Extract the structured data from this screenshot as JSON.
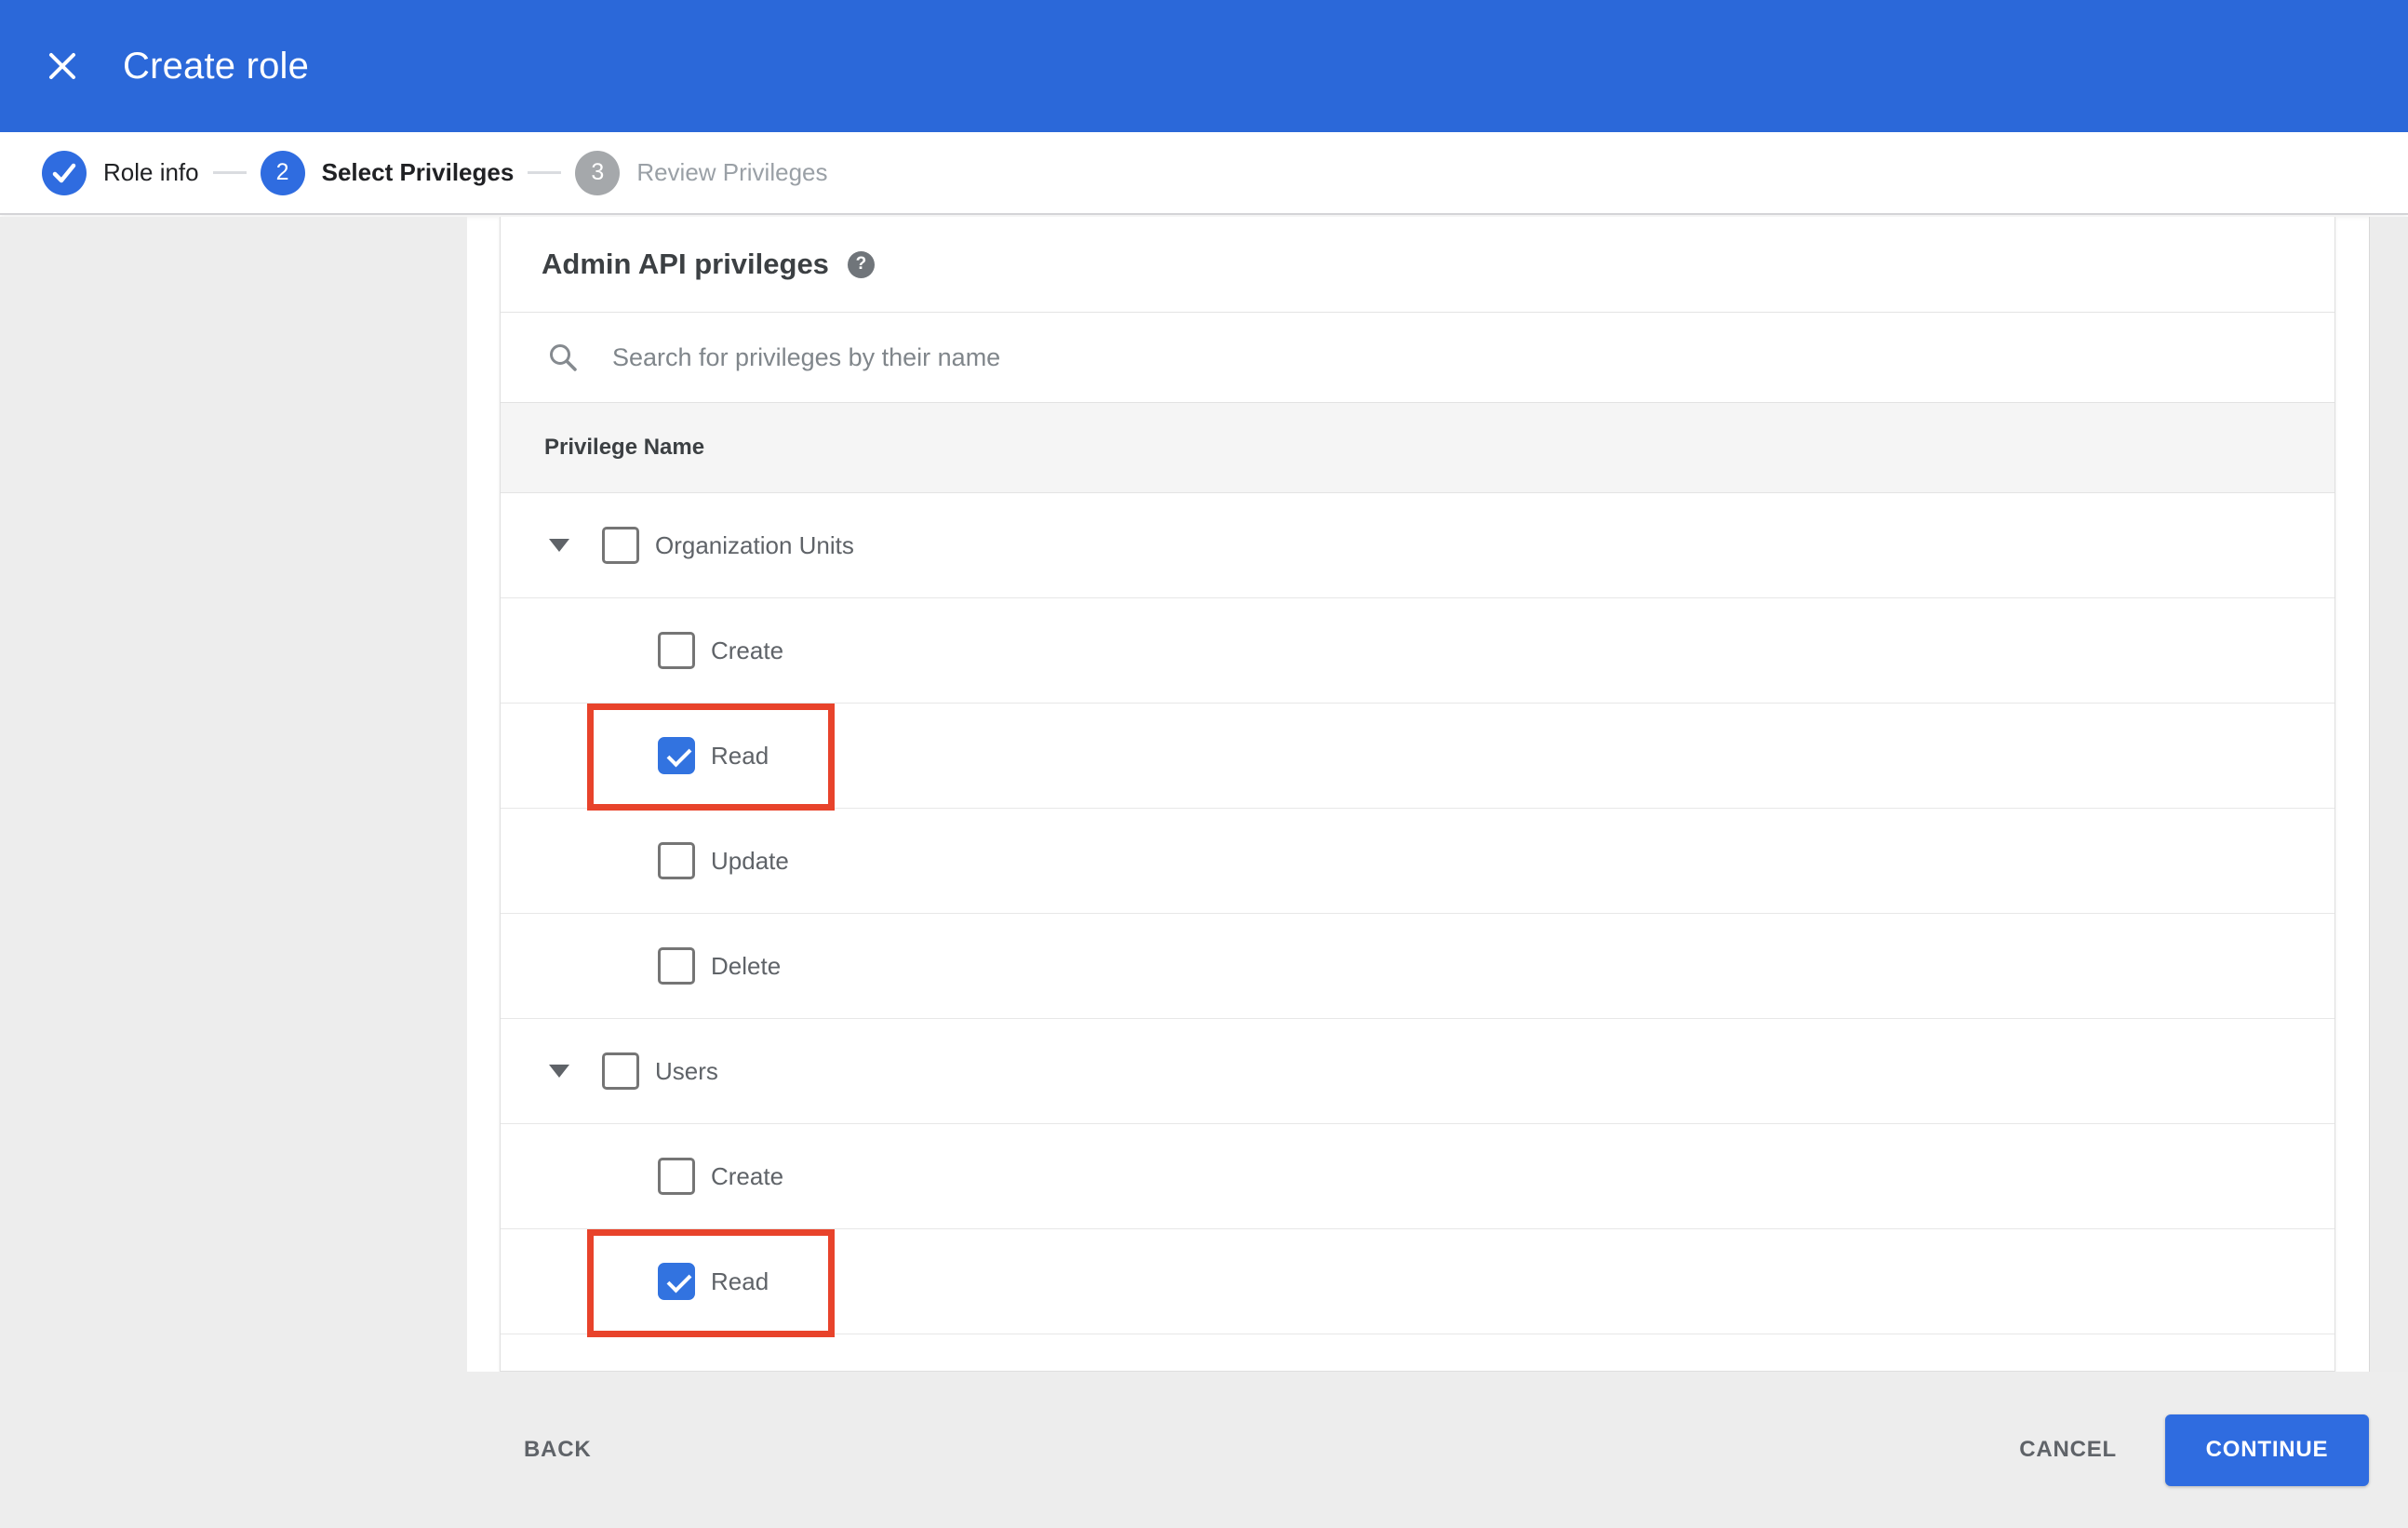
{
  "header": {
    "title": "Create role"
  },
  "stepper": {
    "steps": [
      {
        "label": "Role info",
        "state": "completed"
      },
      {
        "number": "2",
        "label": "Select Privileges",
        "state": "active"
      },
      {
        "number": "3",
        "label": "Review Privileges",
        "state": "upcoming"
      }
    ]
  },
  "panel": {
    "heading": "Admin API privileges",
    "help_icon": "?",
    "search_placeholder": "Search for privileges by their name",
    "search_value": "",
    "table_header": "Privilege Name",
    "groups": [
      {
        "label": "Organization Units",
        "checked": false,
        "expanded": true,
        "children": [
          {
            "label": "Create",
            "checked": false,
            "highlighted": false
          },
          {
            "label": "Read",
            "checked": true,
            "highlighted": true
          },
          {
            "label": "Update",
            "checked": false,
            "highlighted": false
          },
          {
            "label": "Delete",
            "checked": false,
            "highlighted": false
          }
        ]
      },
      {
        "label": "Users",
        "checked": false,
        "expanded": true,
        "children": [
          {
            "label": "Create",
            "checked": false,
            "highlighted": false
          },
          {
            "label": "Read",
            "checked": true,
            "highlighted": true
          }
        ]
      }
    ]
  },
  "footer": {
    "back_label": "BACK",
    "cancel_label": "CANCEL",
    "continue_label": "CONTINUE"
  },
  "colors": {
    "header_blue": "#2b68d9",
    "accent_blue": "#2f6ce0",
    "checkbox_blue": "#3273e0",
    "annotation_red": "#e8432b",
    "panel_gray": "#ededed",
    "band_gray": "#f5f5f5",
    "label_gray": "#5f6368",
    "muted_gray": "#9aa0a6"
  }
}
